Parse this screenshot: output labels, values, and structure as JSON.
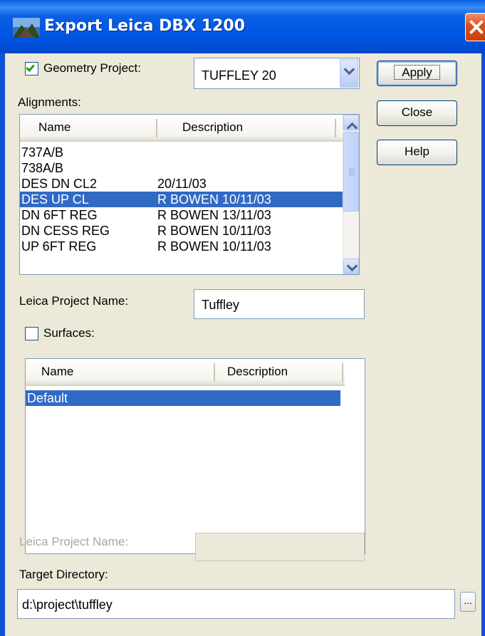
{
  "window": {
    "title": "Export Leica DBX 1200",
    "colors": {
      "titlebar": "#0054e3",
      "selection": "#316ac5",
      "face": "#ece9d8",
      "close": "#e2521b"
    }
  },
  "geometry_project": {
    "label": "Geometry Project:",
    "checked": true,
    "value": "TUFFLEY 20"
  },
  "buttons": {
    "apply": "Apply",
    "close": "Close",
    "help": "Help"
  },
  "alignments": {
    "label": "Alignments:",
    "columns": [
      "Name",
      "Description"
    ],
    "rows": [
      {
        "name": "737A/B",
        "description": ""
      },
      {
        "name": "738A/B",
        "description": ""
      },
      {
        "name": "DES DN CL2",
        "description": "20/11/03"
      },
      {
        "name": "DES UP CL",
        "description": "R BOWEN 10/11/03",
        "selected": true
      },
      {
        "name": "DN 6FT REG",
        "description": "R BOWEN 13/11/03"
      },
      {
        "name": "DN CESS REG",
        "description": "R BOWEN 10/11/03"
      },
      {
        "name": "UP 6FT REG",
        "description": "R BOWEN 10/11/03"
      }
    ]
  },
  "leica_project_name": {
    "label": "Leica Project Name:",
    "value": "Tuffley"
  },
  "surfaces": {
    "label": "Surfaces:",
    "checked": false,
    "columns": [
      "Name",
      "Description"
    ],
    "rows": [
      {
        "name": "Default",
        "description": "",
        "selected": true
      }
    ]
  },
  "surface_project_name": {
    "label": "Leica Project Name:",
    "value": ""
  },
  "target_directory": {
    "label": "Target Directory:",
    "value": "d:\\project\\tuffley",
    "browse_label": "..."
  }
}
